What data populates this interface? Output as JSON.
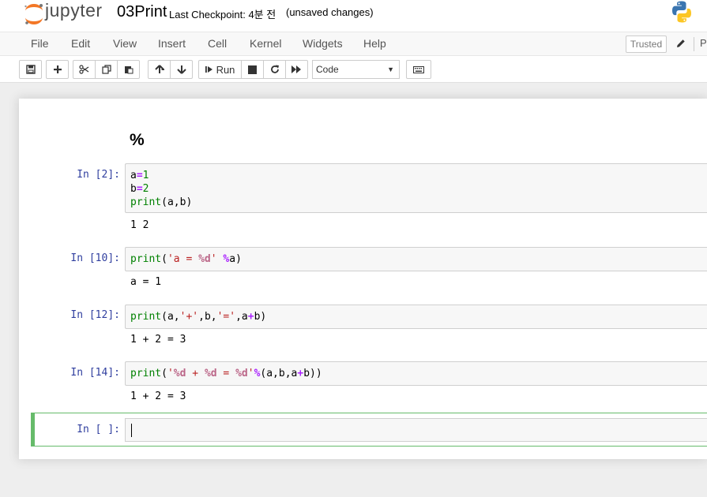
{
  "header": {
    "logo_text": "jupyter",
    "notebook_name": "03Print",
    "checkpoint": "Last Checkpoint: 4분 전",
    "status": "(unsaved changes)"
  },
  "menubar": {
    "items": [
      "File",
      "Edit",
      "View",
      "Insert",
      "Cell",
      "Kernel",
      "Widgets",
      "Help"
    ],
    "trusted": "Trusted",
    "kernel_indicator": "P"
  },
  "toolbar": {
    "run_label": "Run",
    "cell_type": "Code",
    "icons": [
      "save-icon",
      "plus-icon",
      "cut-icon",
      "copy-icon",
      "paste-icon",
      "arrow-up-icon",
      "arrow-down-icon",
      "run-icon",
      "stop-icon",
      "restart-icon",
      "fast-forward-icon",
      "keyboard-icon"
    ]
  },
  "notebook": {
    "markdown_heading": "%",
    "cells": [
      {
        "prompt": "In [2]:",
        "code": [
          [
            "a",
            "=",
            "1"
          ],
          [
            "b",
            "=",
            "2"
          ],
          [
            "print",
            "(a,b)"
          ]
        ],
        "output": "1 2"
      },
      {
        "prompt": "In [10]:",
        "code_text": "print('a = %d' %a)",
        "output": "a = 1"
      },
      {
        "prompt": "In [12]:",
        "code_text": "print(a,'+',b,'=',a+b)",
        "output": "1 + 2 = 3"
      },
      {
        "prompt": "In [14]:",
        "code_text": "print('%d + %d = %d'%(a,b,a+b))",
        "output": "1 + 2 = 3"
      },
      {
        "prompt": "In [ ]:",
        "code_text": "",
        "output": ""
      }
    ]
  },
  "colors": {
    "prompt_in": "#303f9f",
    "keyword_green": "#008000",
    "operator_purple": "#aa22ff",
    "string_red": "#ba2121",
    "active_border": "#66bb6a"
  }
}
